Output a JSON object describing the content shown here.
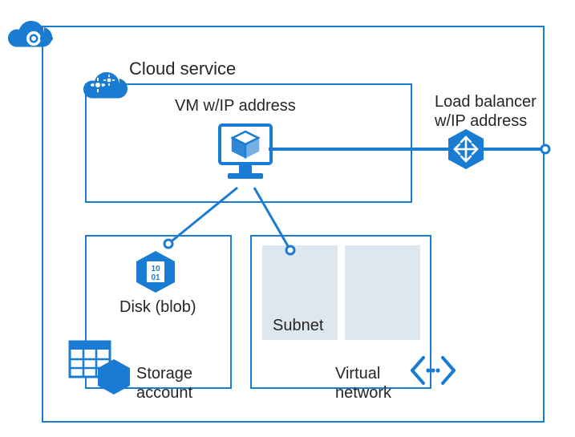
{
  "labels": {
    "cloud_service": "Cloud service",
    "vm_ip": "VM w/IP address",
    "load_balancer_line1": "Load balancer",
    "load_balancer_line2": "w/IP address",
    "disk_blob": "Disk (blob)",
    "storage_line1": "Storage",
    "storage_line2": "account",
    "virtual_line1": "Virtual",
    "virtual_line2": "network",
    "subnet": "Subnet"
  },
  "colors": {
    "azure": "#1a7bd3",
    "azure_dark": "#0f5ea3",
    "panel": "#dfe7ee"
  }
}
